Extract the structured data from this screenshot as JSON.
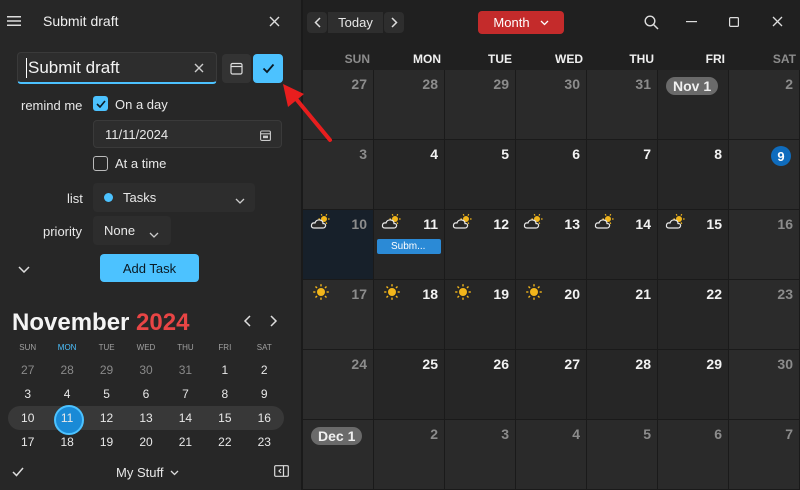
{
  "panel": {
    "title": "Submit draft",
    "task_title": "Submit draft",
    "remind_label": "remind me",
    "on_a_day": "On a day",
    "date": "11/11/2024",
    "at_a_time": "At a time",
    "list_label": "list",
    "list_value": "Tasks",
    "priority_label": "priority",
    "priority_value": "None",
    "add_task": "Add Task",
    "accent": "#4cc2ff"
  },
  "mini_cal": {
    "month": "November",
    "year": "2024",
    "dow": [
      "SUN",
      "MON",
      "TUE",
      "WED",
      "THU",
      "FRI",
      "SAT"
    ],
    "weeks": [
      [
        "27",
        "28",
        "29",
        "30",
        "31",
        "1",
        "2"
      ],
      [
        "3",
        "4",
        "5",
        "6",
        "7",
        "8",
        "9"
      ],
      [
        "10",
        "11",
        "12",
        "13",
        "14",
        "15",
        "16"
      ],
      [
        "17",
        "18",
        "19",
        "20",
        "21",
        "22",
        "23"
      ]
    ],
    "today": "11"
  },
  "footer": {
    "stuff": "My Stuff"
  },
  "toolbar": {
    "today": "Today",
    "view": "Month",
    "view_color": "#c42b2b"
  },
  "calendar": {
    "dow": [
      "SUN",
      "MON",
      "TUE",
      "WED",
      "THU",
      "FRI",
      "SAT"
    ],
    "weeks": [
      [
        "27",
        "28",
        "29",
        "30",
        "31",
        "Nov 1",
        "2"
      ],
      [
        "3",
        "4",
        "5",
        "6",
        "7",
        "8",
        "9"
      ],
      [
        "10",
        "11",
        "12",
        "13",
        "14",
        "15",
        "16"
      ],
      [
        "17",
        "18",
        "19",
        "20",
        "21",
        "22",
        "23"
      ],
      [
        "24",
        "25",
        "26",
        "27",
        "28",
        "29",
        "30"
      ],
      [
        "Dec 1",
        "2",
        "3",
        "4",
        "5",
        "6",
        "7"
      ]
    ],
    "weather": {
      "2": [
        "partly-cloudy-icon",
        "partly-cloudy-icon",
        "partly-cloudy-icon",
        "partly-cloudy-icon",
        "partly-cloudy-icon",
        "partly-cloudy-icon"
      ],
      "3": [
        "sun-icon",
        "sun-icon",
        "sun-icon",
        "sun-icon"
      ]
    },
    "event": "Subm...",
    "event_color": "#2b8ad6"
  }
}
